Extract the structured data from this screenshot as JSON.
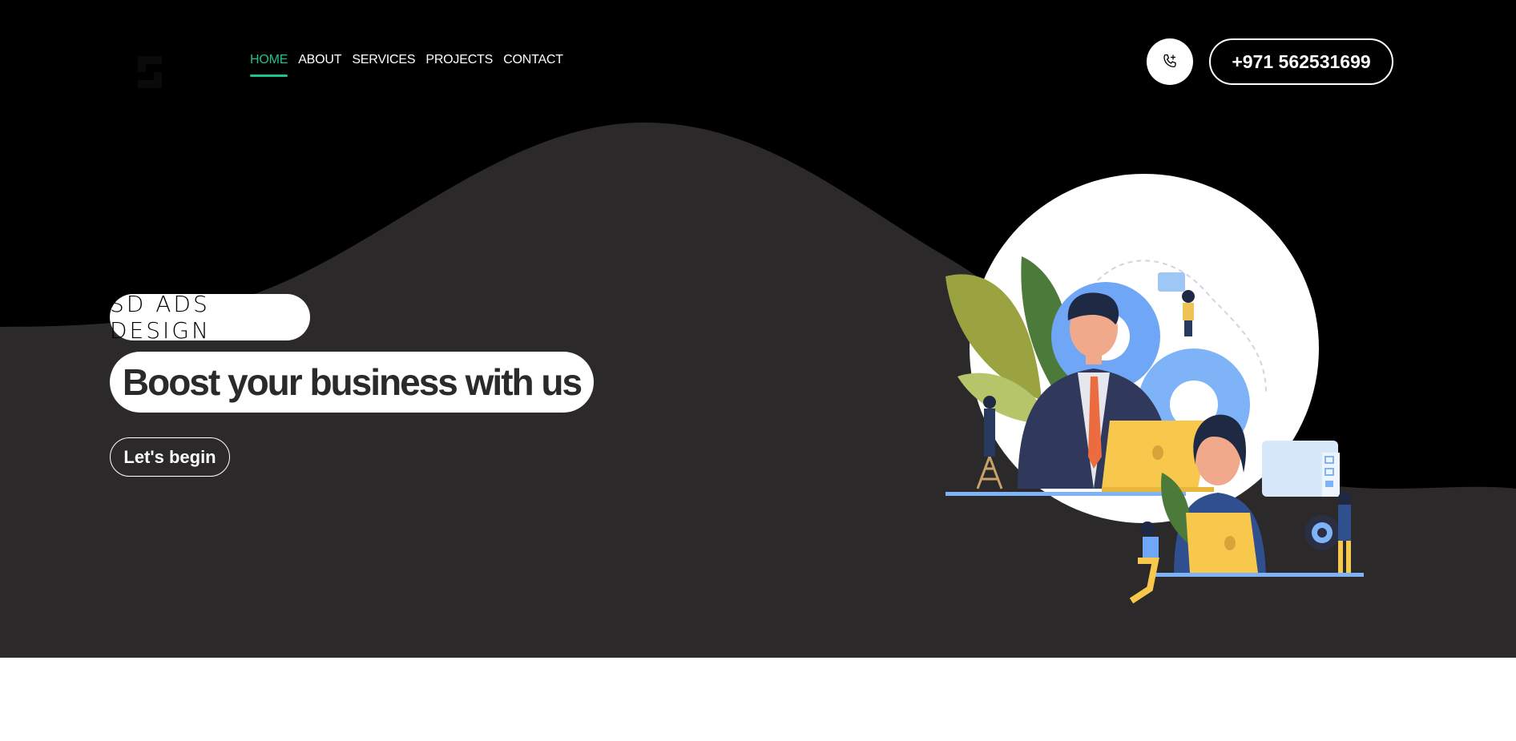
{
  "nav": {
    "items": [
      "HOME",
      "ABOUT",
      "SERVICES",
      "PROJECTS",
      "CONTACT"
    ],
    "active": "HOME"
  },
  "header": {
    "phone_number": "+971 562531699",
    "phone_icon": "phone-icon"
  },
  "hero": {
    "brand": "SD ADS DESIGN",
    "headline": "Boost your business with us",
    "cta": "Let's begin"
  },
  "colors": {
    "background": "#000000",
    "wave": "#2b292a",
    "accent": "#1ec28b",
    "white": "#ffffff"
  }
}
